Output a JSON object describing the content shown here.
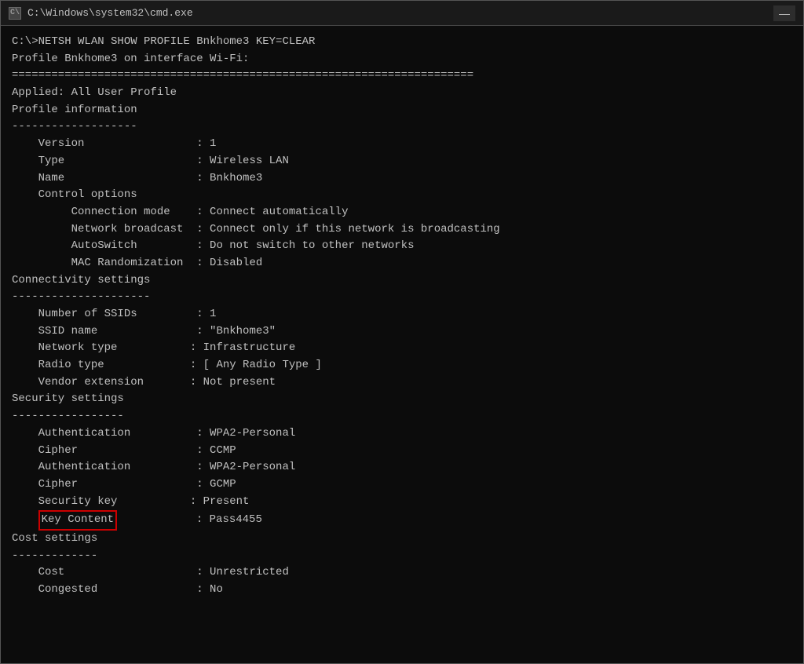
{
  "window": {
    "title": "C:\\Windows\\system32\\cmd.exe",
    "icon_label": "C:\\",
    "minimize_label": "—"
  },
  "terminal": {
    "lines": [
      {
        "id": "blank1",
        "text": ""
      },
      {
        "id": "command",
        "text": "C:\\>NETSH WLAN SHOW PROFILE Bnkhome3 KEY=CLEAR"
      },
      {
        "id": "blank2",
        "text": ""
      },
      {
        "id": "profile_header",
        "text": "Profile Bnkhome3 on interface Wi-Fi:"
      },
      {
        "id": "separator1",
        "text": "======================================================================"
      },
      {
        "id": "blank3",
        "text": ""
      },
      {
        "id": "applied",
        "text": "Applied: All User Profile"
      },
      {
        "id": "blank4",
        "text": ""
      },
      {
        "id": "profile_info",
        "text": "Profile information"
      },
      {
        "id": "separator2",
        "text": "-------------------"
      },
      {
        "id": "version",
        "text": "    Version                 : 1"
      },
      {
        "id": "type",
        "text": "    Type                    : Wireless LAN"
      },
      {
        "id": "name",
        "text": "    Name                    : Bnkhome3"
      },
      {
        "id": "control_options",
        "text": "    Control options"
      },
      {
        "id": "connection_mode",
        "text": "         Connection mode    : Connect automatically"
      },
      {
        "id": "network_broadcast",
        "text": "         Network broadcast  : Connect only if this network is broadcasting"
      },
      {
        "id": "autoswitch",
        "text": "         AutoSwitch         : Do not switch to other networks"
      },
      {
        "id": "mac_rand",
        "text": "         MAC Randomization  : Disabled"
      },
      {
        "id": "blank5",
        "text": ""
      },
      {
        "id": "connectivity",
        "text": "Connectivity settings"
      },
      {
        "id": "separator3",
        "text": "---------------------"
      },
      {
        "id": "num_ssids",
        "text": "    Number of SSIDs         : 1"
      },
      {
        "id": "ssid_name",
        "text": "    SSID name               : \"Bnkhome3\""
      },
      {
        "id": "network_type",
        "text": "    Network type           : Infrastructure"
      },
      {
        "id": "radio_type",
        "text": "    Radio type             : [ Any Radio Type ]"
      },
      {
        "id": "vendor_ext",
        "text": "    Vendor extension       : Not present"
      },
      {
        "id": "blank6",
        "text": ""
      },
      {
        "id": "security",
        "text": "Security settings"
      },
      {
        "id": "separator4",
        "text": "-----------------"
      },
      {
        "id": "auth1",
        "text": "    Authentication          : WPA2-Personal"
      },
      {
        "id": "cipher1",
        "text": "    Cipher                  : CCMP"
      },
      {
        "id": "auth2",
        "text": "    Authentication          : WPA2-Personal"
      },
      {
        "id": "cipher2",
        "text": "    Cipher                  : GCMP"
      },
      {
        "id": "security_key",
        "text": "    Security key           : Present"
      },
      {
        "id": "key_content",
        "text": "    Key Content            : Pass4455",
        "highlight": true
      },
      {
        "id": "blank7",
        "text": ""
      },
      {
        "id": "cost_settings",
        "text": "Cost settings"
      },
      {
        "id": "separator5",
        "text": "-------------"
      },
      {
        "id": "cost",
        "text": "    Cost                    : Unrestricted"
      },
      {
        "id": "congested",
        "text": "    Congested               : No"
      }
    ]
  }
}
